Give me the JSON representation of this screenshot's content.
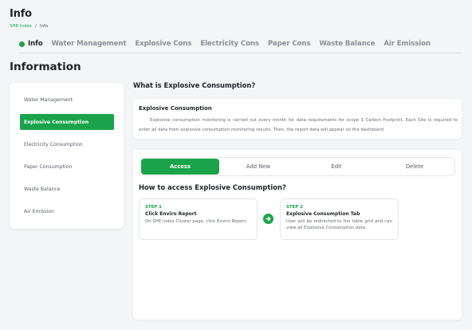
{
  "page": {
    "title": "Info",
    "breadcrumb": {
      "link": "SHE Index",
      "separator": "/",
      "current": "Info"
    }
  },
  "tabs": [
    {
      "label": "Info",
      "active": true
    },
    {
      "label": "Water Management"
    },
    {
      "label": "Explosive Cons"
    },
    {
      "label": "Electricity Cons"
    },
    {
      "label": "Paper Cons"
    },
    {
      "label": "Waste Balance"
    },
    {
      "label": "Air Emission"
    }
  ],
  "section_heading": "Information",
  "sidebar": {
    "items": [
      {
        "label": "Water Management"
      },
      {
        "label": "Explosive Consumption",
        "active": true
      },
      {
        "label": "Electricity Consumption"
      },
      {
        "label": "Paper Consumption"
      },
      {
        "label": "Waste Balance"
      },
      {
        "label": "Air Emission"
      }
    ]
  },
  "what": {
    "title": "What is Explosive Consumption?",
    "card_heading": "Explosive Consumption",
    "card_body": "Explosive consumption monitoring is carried out every month for data requirements for scope 1 Carbon Footprint. Each Site is required to enter all data from explosive consumption monitoring results. Then, the report data will appear on the dashboard."
  },
  "segmented": {
    "options": [
      {
        "label": "Access",
        "active": true
      },
      {
        "label": "Add New"
      },
      {
        "label": "Edit"
      },
      {
        "label": "Delete"
      }
    ]
  },
  "how": {
    "title": "How to access Explosive Consumption?",
    "steps": [
      {
        "label": "STEP 1",
        "title": "Click Enviro Report",
        "body": "On SHE Index Cluster page, click Enviro Report."
      },
      {
        "label": "STEP 2",
        "title": "Explosive Consumption Tab",
        "body": "User will be redirected to the table grid and can view all Explosive Consumption data."
      }
    ]
  },
  "colors": {
    "accent": "#1aa34a",
    "background": "#f3f5f7",
    "card": "#ffffff"
  },
  "icons": {
    "active_tab_marker": "dot-icon",
    "step_connector": "arrow-right-circle-icon"
  }
}
